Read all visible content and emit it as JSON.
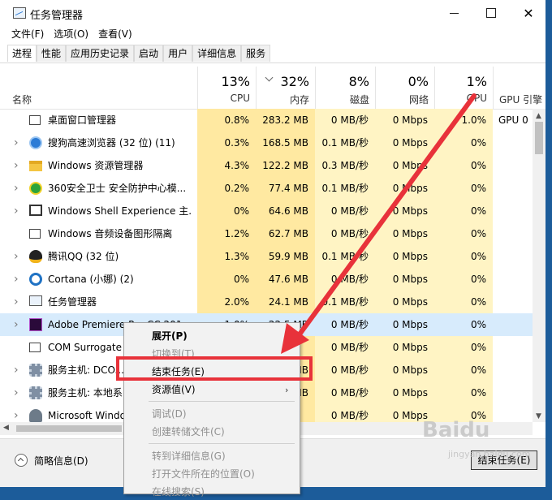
{
  "window": {
    "title": "任务管理器"
  },
  "menu": [
    "文件(F)",
    "选项(O)",
    "查看(V)"
  ],
  "tabs": [
    "进程",
    "性能",
    "应用历史记录",
    "启动",
    "用户",
    "详细信息",
    "服务"
  ],
  "header": {
    "name": "名称",
    "cpu_pct": "13%",
    "cpu": "CPU",
    "mem_pct": "32%",
    "mem": "内存",
    "disk_pct": "8%",
    "disk": "磁盘",
    "net_pct": "0%",
    "net": "网络",
    "gpu_pct": "1%",
    "gpu": "GPU",
    "gpu_engine": "GPU 引擎"
  },
  "rows": [
    {
      "name": "桌面窗口管理器",
      "cpu": "0.8%",
      "mem": "283.2 MB",
      "disk": "0 MB/秒",
      "net": "0 Mbps",
      "gpu": "1.0%",
      "gpue": "GPU 0",
      "expand": "",
      "icon": "window-icon"
    },
    {
      "name": "搜狗高速浏览器 (32 位) (11)",
      "cpu": "0.3%",
      "mem": "168.5 MB",
      "disk": "0.1 MB/秒",
      "net": "0 Mbps",
      "gpu": "0%",
      "gpue": "",
      "expand": "›",
      "icon": "sogou-browser-icon"
    },
    {
      "name": "Windows 资源管理器",
      "cpu": "4.3%",
      "mem": "122.2 MB",
      "disk": "0.3 MB/秒",
      "net": "0 Mbps",
      "gpu": "0%",
      "gpue": "",
      "expand": "›",
      "icon": "folder-icon"
    },
    {
      "name": "360安全卫士 安全防护中心模...",
      "cpu": "0.2%",
      "mem": "77.4 MB",
      "disk": "0.1 MB/秒",
      "net": "0 Mbps",
      "gpu": "0%",
      "gpue": "",
      "expand": "›",
      "icon": "360-security-icon"
    },
    {
      "name": "Windows Shell Experience 主...",
      "cpu": "0%",
      "mem": "64.6 MB",
      "disk": "0 MB/秒",
      "net": "0 Mbps",
      "gpu": "0%",
      "gpue": "",
      "expand": "›",
      "icon": "shell-icon"
    },
    {
      "name": "Windows 音频设备图形隔离",
      "cpu": "1.2%",
      "mem": "62.7 MB",
      "disk": "0 MB/秒",
      "net": "0 Mbps",
      "gpu": "0%",
      "gpue": "",
      "expand": "",
      "icon": "window-icon"
    },
    {
      "name": "腾讯QQ (32 位)",
      "cpu": "1.3%",
      "mem": "59.9 MB",
      "disk": "0.1 MB/秒",
      "net": "0 Mbps",
      "gpu": "0%",
      "gpue": "",
      "expand": "›",
      "icon": "qq-penguin-icon"
    },
    {
      "name": "Cortana (小娜) (2)",
      "cpu": "0%",
      "mem": "47.6 MB",
      "disk": "0 MB/秒",
      "net": "0 Mbps",
      "gpu": "0%",
      "gpue": "",
      "expand": "›",
      "icon": "cortana-icon"
    },
    {
      "name": "任务管理器",
      "cpu": "2.0%",
      "mem": "24.1 MB",
      "disk": "0.1 MB/秒",
      "net": "0 Mbps",
      "gpu": "0%",
      "gpue": "",
      "expand": "›",
      "icon": "task-manager-icon"
    },
    {
      "name": "Adobe Premiere Pro CC 201...",
      "cpu": "1.0%",
      "mem": "22.5 MB",
      "disk": "0 MB/秒",
      "net": "0 Mbps",
      "gpu": "0%",
      "gpue": "",
      "expand": "›",
      "icon": "premiere-icon"
    },
    {
      "name": "COM Surrogate",
      "cpu": "",
      "mem": "",
      "disk": "0 MB/秒",
      "net": "0 Mbps",
      "gpu": "0%",
      "gpue": "",
      "expand": "",
      "icon": "window-icon"
    },
    {
      "name": "服务主机: DCO...",
      "cpu": "",
      "mem": "MB",
      "disk": "0 MB/秒",
      "net": "0 Mbps",
      "gpu": "0%",
      "gpue": "",
      "expand": "›",
      "icon": "gear-icon"
    },
    {
      "name": "服务主机: 本地系...",
      "cpu": "",
      "mem": "MB",
      "disk": "0 MB/秒",
      "net": "0 Mbps",
      "gpu": "0%",
      "gpue": "",
      "expand": "›",
      "icon": "gear-icon"
    },
    {
      "name": "Microsoft Windo...",
      "cpu": "",
      "mem": "",
      "disk": "0 MB/秒",
      "net": "0 Mbps",
      "gpu": "0%",
      "gpue": "",
      "expand": "›",
      "icon": "user-icon"
    }
  ],
  "context_menu": {
    "expand": "展开(P)",
    "switch_to": "切换到(T)",
    "end_task": "结束任务(E)",
    "resource_values": "资源值(V)",
    "debug": "调试(D)",
    "create_dump": "创建转储文件(C)",
    "goto_details": "转到详细信息(G)",
    "open_location": "打开文件所在的位置(O)",
    "search_online": "在线搜索(S)"
  },
  "footer": {
    "fewer_details": "简略信息(D)",
    "end_task": "结束任务(E)"
  },
  "watermark": {
    "main": "Baidu",
    "sub": "jingyan.baidu.com"
  },
  "colors": {
    "highlight_row": "#d7ebfc",
    "cpu_mem_bg": "#ffe9a1",
    "cell_bg": "#fff4c4",
    "annotation": "#e8323a"
  }
}
